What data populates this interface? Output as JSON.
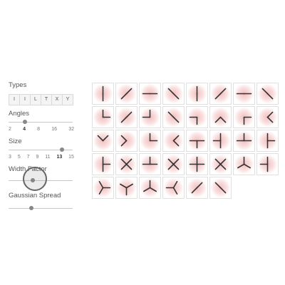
{
  "controls": {
    "types": {
      "label": "Types",
      "options": [
        "I",
        "I",
        "L",
        "T",
        "X",
        "Y"
      ]
    },
    "angles": {
      "label": "Angles",
      "ticks": [
        "2",
        "4",
        "8",
        "16",
        "32"
      ],
      "active": "4",
      "value_fraction": 0.25
    },
    "size": {
      "label": "Size",
      "ticks": [
        "3",
        "5",
        "7",
        "9",
        "11",
        "13",
        "15"
      ],
      "active": "13",
      "value_fraction": 0.83
    },
    "width_factor": {
      "label": "Width Factor",
      "value_fraction": 0.38
    },
    "gaussian_spread": {
      "label": "Gaussian Spread",
      "value_fraction": 0.36
    }
  },
  "kernels": {
    "rows": [
      [
        {
          "type": "I",
          "angle": 90
        },
        {
          "type": "I",
          "angle": 45
        },
        {
          "type": "I",
          "angle": 0
        },
        {
          "type": "I",
          "angle": 135
        },
        {
          "type": "I",
          "angle": 90
        },
        {
          "type": "I",
          "angle": 45
        },
        {
          "type": "I",
          "angle": 0
        },
        {
          "type": "I",
          "angle": 135
        }
      ],
      [
        {
          "type": "L",
          "angle": 0
        },
        {
          "type": "I",
          "angle": 45
        },
        {
          "type": "L",
          "angle": 90
        },
        {
          "type": "I",
          "angle": 135
        },
        {
          "type": "L",
          "angle": 180
        },
        {
          "type": "L",
          "angle": 225
        },
        {
          "type": "L",
          "angle": 270
        },
        {
          "type": "L",
          "angle": 315
        }
      ],
      [
        {
          "type": "L",
          "angle": 45
        },
        {
          "type": "L",
          "angle": 135
        },
        {
          "type": "L",
          "angle": 0
        },
        {
          "type": "L",
          "angle": 315
        },
        {
          "type": "T",
          "angle": 180
        },
        {
          "type": "T",
          "angle": 90
        },
        {
          "type": "T",
          "angle": 0
        },
        {
          "type": "T",
          "angle": 270
        }
      ],
      [
        {
          "type": "T",
          "angle": 270
        },
        {
          "type": "X",
          "angle": 45
        },
        {
          "type": "T",
          "angle": 0
        },
        {
          "type": "X",
          "angle": 45
        },
        {
          "type": "X",
          "angle": 0
        },
        {
          "type": "X",
          "angle": 45
        },
        {
          "type": "Y",
          "angle": 0
        },
        {
          "type": "T",
          "angle": 90
        }
      ],
      [
        {
          "type": "Y",
          "angle": 270
        },
        {
          "type": "Y",
          "angle": 180
        },
        {
          "type": "Y",
          "angle": 0
        },
        {
          "type": "Y",
          "angle": 90
        },
        {
          "type": "I",
          "angle": 45
        },
        {
          "type": "I",
          "angle": 135
        }
      ]
    ]
  },
  "colors": {
    "glow": "#f2b8b8",
    "stroke": "#333333"
  }
}
